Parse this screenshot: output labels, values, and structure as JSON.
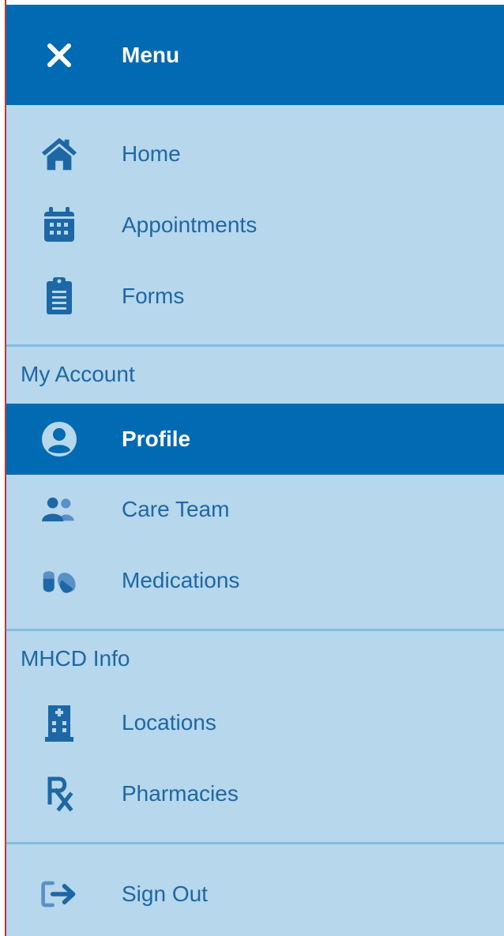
{
  "header": {
    "close_icon": "close-icon",
    "title": "Menu"
  },
  "primary_nav": [
    {
      "label": "Home",
      "icon": "home-icon"
    },
    {
      "label": "Appointments",
      "icon": "calendar-icon"
    },
    {
      "label": "Forms",
      "icon": "clipboard-icon"
    }
  ],
  "sections": [
    {
      "title": "My Account",
      "items": [
        {
          "label": "Profile",
          "icon": "user-circle-icon",
          "active": true
        },
        {
          "label": "Care Team",
          "icon": "users-icon",
          "active": false
        },
        {
          "label": "Medications",
          "icon": "pills-icon",
          "active": false
        }
      ]
    },
    {
      "title": "MHCD Info",
      "items": [
        {
          "label": "Locations",
          "icon": "hospital-building-icon",
          "active": false
        },
        {
          "label": "Pharmacies",
          "icon": "prescription-icon",
          "active": false
        }
      ]
    }
  ],
  "footer": {
    "label": "Sign Out",
    "icon": "sign-out-icon"
  },
  "colors": {
    "header_bg": "#006ab3",
    "menu_bg": "#b6d7ec",
    "text": "#1e67a6",
    "divider": "#85bce0",
    "active_text": "#ffffff"
  }
}
